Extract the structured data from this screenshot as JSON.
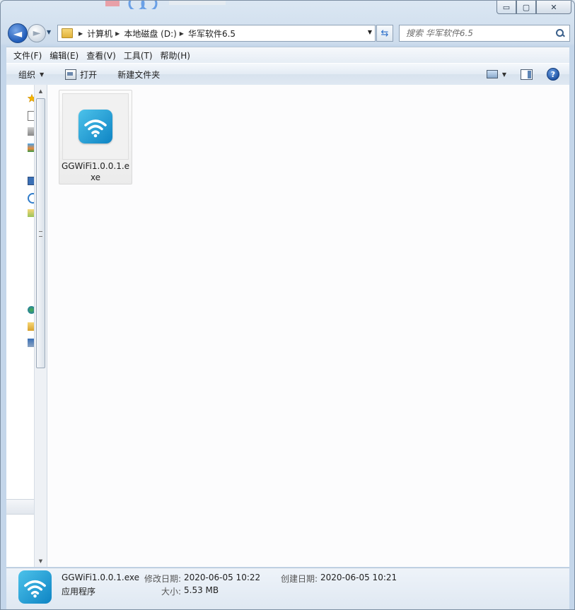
{
  "window": {
    "caption_buttons": {
      "minimize": "▭",
      "maximize": "▢",
      "close": "✕"
    }
  },
  "navigation": {
    "back_glyph": "◄",
    "forward_glyph": "►",
    "breadcrumbs": [
      "计算机",
      "本地磁盘 (D:)",
      "华军软件6.5"
    ],
    "search_placeholder": "搜索 华军软件6.5"
  },
  "menu": [
    "文件(F)",
    "编辑(E)",
    "查看(V)",
    "工具(T)",
    "帮助(H)"
  ],
  "toolbar": {
    "organize_label": "组织",
    "open_label": "打开",
    "new_folder_label": "新建文件夹",
    "help_glyph": "?"
  },
  "files": [
    {
      "name": "GGWiFi1.0.0.1.exe",
      "icon": "wifi-app-icon"
    }
  ],
  "details": {
    "filename": "GGWiFi1.0.0.1.exe",
    "type": "应用程序",
    "modified_label": "修改日期:",
    "modified_value": "2020-06-05 10:22",
    "created_label": "创建日期:",
    "created_value": "2020-06-05 10:21",
    "size_label": "大小:",
    "size_value": "5.53 MB"
  },
  "colors": {
    "wifi_icon_gradient_start": "#4cc2ea",
    "wifi_icon_gradient_end": "#0e84c4",
    "back_button": "#1f5bb8"
  }
}
